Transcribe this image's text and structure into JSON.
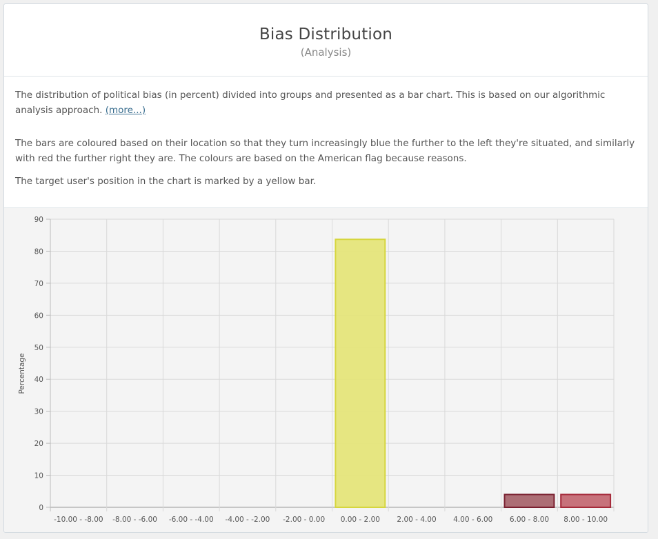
{
  "header": {
    "title": "Bias Distribution",
    "subtitle": "(Analysis)"
  },
  "description": {
    "p1_text": "The distribution of political bias (in percent) divided into groups and presented as a bar chart. This is based on our algorithmic analysis approach. ",
    "p1_link_open": "(",
    "p1_link": "more...",
    "p1_link_close": ")",
    "p2_text": "The bars are coloured based on their location so that they turn increasingly blue the further to the left they're situated, and similarly with red the further right they are. The colours are based on the American flag because reasons.",
    "p3_text": "The target user's position in the chart is marked by a yellow bar."
  },
  "chart_data": {
    "type": "bar",
    "categories": [
      "-10.00 - -8.00",
      "-8.00 - -6.00",
      "-6.00 - -4.00",
      "-4.00 - -2.00",
      "-2.00 - 0.00",
      "0.00 - 2.00",
      "2.00 - 4.00",
      "4.00 - 6.00",
      "6.00 - 8.00",
      "8.00 - 10.00"
    ],
    "values": [
      0,
      0,
      0,
      0,
      0,
      83.7,
      0,
      0,
      4,
      4
    ],
    "bar_colors": [
      "#3b5998",
      "#4a66a0",
      "#5a73a8",
      "#6a80b0",
      "#7a8db8",
      "#e5e57a",
      "#c0a0a0",
      "#b08888",
      "#a8666e",
      "#c46a74"
    ],
    "bar_borders": [
      "#3b5998",
      "#4a66a0",
      "#5a73a8",
      "#6a80b0",
      "#7a8db8",
      "#d6d63e",
      "#c0a0a0",
      "#b08888",
      "#7a2030",
      "#a52a3a"
    ],
    "ylabel": "Percentage",
    "xlabel": "",
    "title": "",
    "ylim": [
      0,
      90
    ],
    "yticks": [
      0,
      10,
      20,
      30,
      40,
      50,
      60,
      70,
      80,
      90
    ],
    "grid": true,
    "legend": "none"
  }
}
